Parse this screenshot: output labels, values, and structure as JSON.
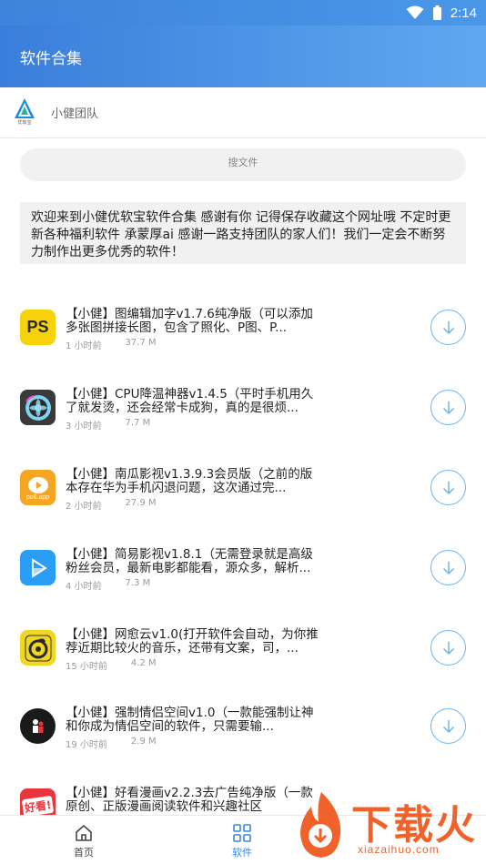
{
  "status_bar": {
    "time": "2:14"
  },
  "app_bar": {
    "title": "软件合集"
  },
  "team": {
    "name": "小健团队",
    "logo_sub": "优软宝"
  },
  "search": {
    "placeholder": "搜文件"
  },
  "notice": {
    "text": "欢迎来到小健优软宝软件合集 感谢有你 记得保存收藏这个网址哦 不定时更新各种福利软件 承蒙厚ai 感谢一路支持团队的家人们！我们一定会不断努力制作出更多优秀的软件！"
  },
  "files": [
    {
      "desc": "【小健】图编辑加字v1.7.6纯净版（可以添加多张图拼接长图，包含了照化、P图、P...",
      "time": "1 小时前",
      "size": "37.7 M",
      "icon": "ps-icon",
      "color": "#f5d20a"
    },
    {
      "desc": "【小健】CPU降温神器v1.4.5（平时手机用久了就发烫，还会经常卡成狗，真的是很烦...",
      "time": "3 小时前",
      "size": "7.7 M",
      "icon": "cooling-fan-icon",
      "color": "#3a3a3a"
    },
    {
      "desc": "【小健】南瓜影视v1.3.9.3会员版（之前的版本存在华为手机闪退问题，这次通过完...",
      "time": "2 小时前",
      "size": "27.9 M",
      "icon": "pumpkin-tv-icon",
      "color": "#f5a623"
    },
    {
      "desc": "【小健】简易影视v1.8.1（无需登录就是高级粉丝会员，最新电影都能看，源众多，解析...",
      "time": "4 小时前",
      "size": "7.3 M",
      "icon": "play-icon",
      "color": "#2a9df4"
    },
    {
      "desc": "【小健】网愈云v1.0(打开软件会自动，为你推荐近期比较火的音乐，还带有文案，司，...",
      "time": "15 小时前",
      "size": "4.2 M",
      "icon": "music-disc-icon",
      "color": "#f0d722"
    },
    {
      "desc": "【小健】强制情侣空间v1.0（一款能强制让神和你成为情侣空间的软件，只需要输...",
      "time": "19 小时前",
      "size": "2.9 M",
      "icon": "couple-icon",
      "color": "#1a1a1a"
    },
    {
      "desc": "【小健】好看漫画v2.2.3去广告纯净版（一款原创、正版漫画阅读软件和兴趣社区",
      "time": "",
      "size": "",
      "icon": "comic-icon",
      "color": "#e8363c"
    }
  ],
  "tabs": [
    {
      "label": "首页",
      "icon": "home-icon"
    },
    {
      "label": "软件",
      "icon": "apps-grid-icon"
    }
  ],
  "watermark": {
    "text": "下载火",
    "url": "xiazaihuo.com"
  },
  "colors": {
    "accent": "#3a86e0",
    "download_ring": "#6bb5f0",
    "watermark": "#f0622a"
  }
}
